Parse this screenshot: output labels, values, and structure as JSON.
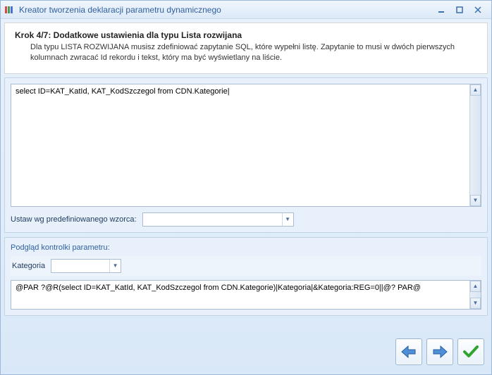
{
  "window": {
    "title": "Kreator tworzenia deklaracji parametru dynamicznego"
  },
  "header": {
    "title": "Krok 4/7: Dodatkowe ustawienia dla typu Lista rozwijana",
    "description": "Dla typu LISTA ROZWIJANA musisz zdefiniować zapytanie SQL, które wypełni listę. Zapytanie to musi w dwóch pierwszych kolumnach zwracać Id rekordu i tekst, który ma być wyświetlany na liście."
  },
  "sql": {
    "query": "select ID=KAT_KatId, KAT_KodSzczegol from CDN.Kategorie|",
    "pattern_label": "Ustaw wg predefiniowanego wzorca:",
    "pattern_value": ""
  },
  "preview": {
    "title": "Podgląd kontrolki parametru:",
    "param_label": "Kategoria",
    "param_value": "",
    "par_string": "@PAR ?@R(select ID=KAT_KatId, KAT_KodSzczegol from CDN.Kategorie)|Kategoria|&Kategoria:REG=0||@? PAR@"
  }
}
